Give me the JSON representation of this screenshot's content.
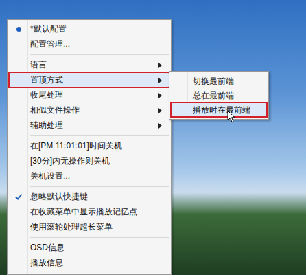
{
  "menu": {
    "groups": [
      [
        {
          "label": "*默认配置",
          "kind": "radio",
          "checked": true,
          "submenu": false,
          "selected": false,
          "annotated": false
        },
        {
          "label": "配置管理...",
          "kind": "plain",
          "checked": false,
          "submenu": false,
          "selected": false,
          "annotated": false
        }
      ],
      [
        {
          "label": "语言",
          "kind": "plain",
          "checked": false,
          "submenu": true,
          "selected": false,
          "annotated": false
        },
        {
          "label": "置顶方式",
          "kind": "plain",
          "checked": false,
          "submenu": true,
          "selected": true,
          "annotated": true
        },
        {
          "label": "收尾处理",
          "kind": "plain",
          "checked": false,
          "submenu": true,
          "selected": false,
          "annotated": false
        },
        {
          "label": "相似文件操作",
          "kind": "plain",
          "checked": false,
          "submenu": true,
          "selected": false,
          "annotated": false
        },
        {
          "label": "辅助处理",
          "kind": "plain",
          "checked": false,
          "submenu": true,
          "selected": false,
          "annotated": false
        }
      ],
      [
        {
          "label": "在[PM 11:01:01]时间关机",
          "kind": "plain",
          "checked": false,
          "submenu": false,
          "selected": false,
          "annotated": false
        },
        {
          "label": "[30分]内无操作则关机",
          "kind": "plain",
          "checked": false,
          "submenu": false,
          "selected": false,
          "annotated": false
        },
        {
          "label": "关机设置...",
          "kind": "plain",
          "checked": false,
          "submenu": false,
          "selected": false,
          "annotated": false
        }
      ],
      [
        {
          "label": "忽略默认快捷键",
          "kind": "check",
          "checked": true,
          "submenu": false,
          "selected": false,
          "annotated": false
        },
        {
          "label": "在收藏菜单中显示播放记忆点",
          "kind": "check",
          "checked": false,
          "submenu": false,
          "selected": false,
          "annotated": false
        },
        {
          "label": "使用滚轮处理超长菜单",
          "kind": "check",
          "checked": false,
          "submenu": false,
          "selected": false,
          "annotated": false
        }
      ],
      [
        {
          "label": "OSD信息",
          "kind": "plain",
          "checked": false,
          "submenu": false,
          "selected": false,
          "annotated": false
        },
        {
          "label": "播放信息",
          "kind": "plain",
          "checked": false,
          "submenu": false,
          "selected": false,
          "annotated": false
        }
      ]
    ]
  },
  "submenu": {
    "items": [
      {
        "label": "切换最前端",
        "selected": false,
        "annotated": false
      },
      {
        "label": "总在最前端",
        "selected": false,
        "annotated": false
      },
      {
        "label": "播放时在最前端",
        "selected": true,
        "annotated": true
      }
    ]
  }
}
